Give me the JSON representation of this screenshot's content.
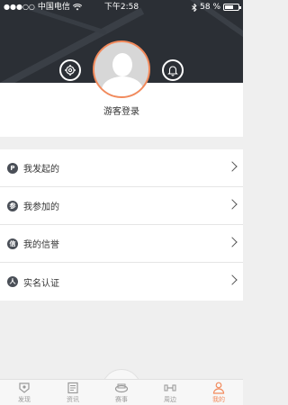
{
  "status_bar": {
    "signal_dots": "●●●○○",
    "carrier": "中国电信",
    "time": "下午2:58",
    "battery_percent": "58 %"
  },
  "profile": {
    "guest_login": "游客登录"
  },
  "menu": {
    "items": [
      {
        "label": "我发起的",
        "icon": "P"
      },
      {
        "label": "我参加的",
        "icon": "参"
      },
      {
        "label": "我的信誉",
        "icon": "信"
      },
      {
        "label": "实名认证",
        "icon": "人"
      }
    ]
  },
  "tabs": [
    {
      "label": "发现"
    },
    {
      "label": "资讯"
    },
    {
      "label": "赛事"
    },
    {
      "label": "周边"
    },
    {
      "label": "我的"
    }
  ],
  "colors": {
    "header_bg": "#2b2f35",
    "accent": "#f28a5c",
    "tab_inactive": "#9a9a9a"
  }
}
